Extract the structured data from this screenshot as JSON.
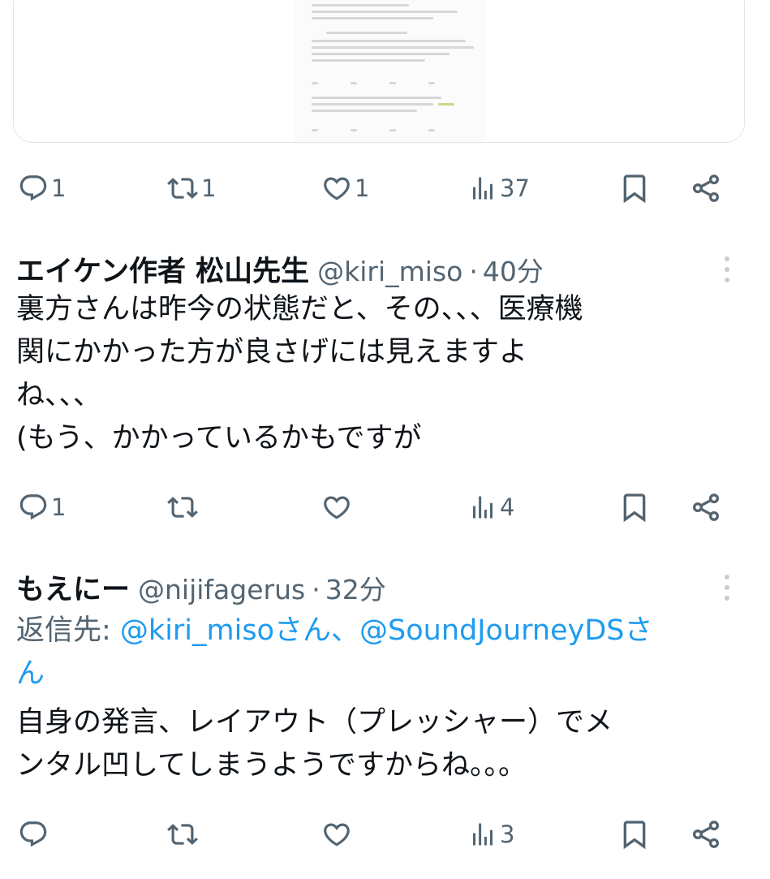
{
  "tweets": [
    {
      "actions": {
        "reply": "1",
        "retweet": "1",
        "like": "1",
        "views": "37"
      }
    },
    {
      "name": "エイケン作者 松山先生",
      "handle": "@kiri_miso",
      "sep": "·",
      "time": "40分",
      "lines": [
        "裏方さんは昨今の状態だと、その、、、医療機",
        "関にかかった方が良さげには見えますよ",
        "ね、、、",
        "(もう、かかっているかもですが"
      ],
      "actions": {
        "reply": "1",
        "retweet": "",
        "like": "",
        "views": "4"
      }
    },
    {
      "name": "もえにー",
      "handle": "@nijifagerus",
      "sep": "·",
      "time": "32分",
      "reply_to_label": "返信先: ",
      "reply_to_user1": "@kiri_misoさん",
      "reply_to_sep": "、",
      "reply_to_user2_a": "@SoundJourneyDSさ",
      "reply_to_user2_b": "ん",
      "lines": [
        "自身の発言、レイアウト（プレッシャー）でメ",
        "ンタル凹してしまうようですからね。。。"
      ],
      "actions": {
        "reply": "",
        "retweet": "",
        "like": "",
        "views": "3"
      }
    }
  ],
  "icons": {
    "reply": "reply-icon",
    "retweet": "retweet-icon",
    "like": "heart-icon",
    "views": "views-icon",
    "bookmark": "bookmark-icon",
    "share": "share-icon",
    "more": "more-icon"
  },
  "colors": {
    "text": "#0f1419",
    "secondary": "#536471",
    "link": "#1d9bf0",
    "border": "#e1e6ea"
  }
}
